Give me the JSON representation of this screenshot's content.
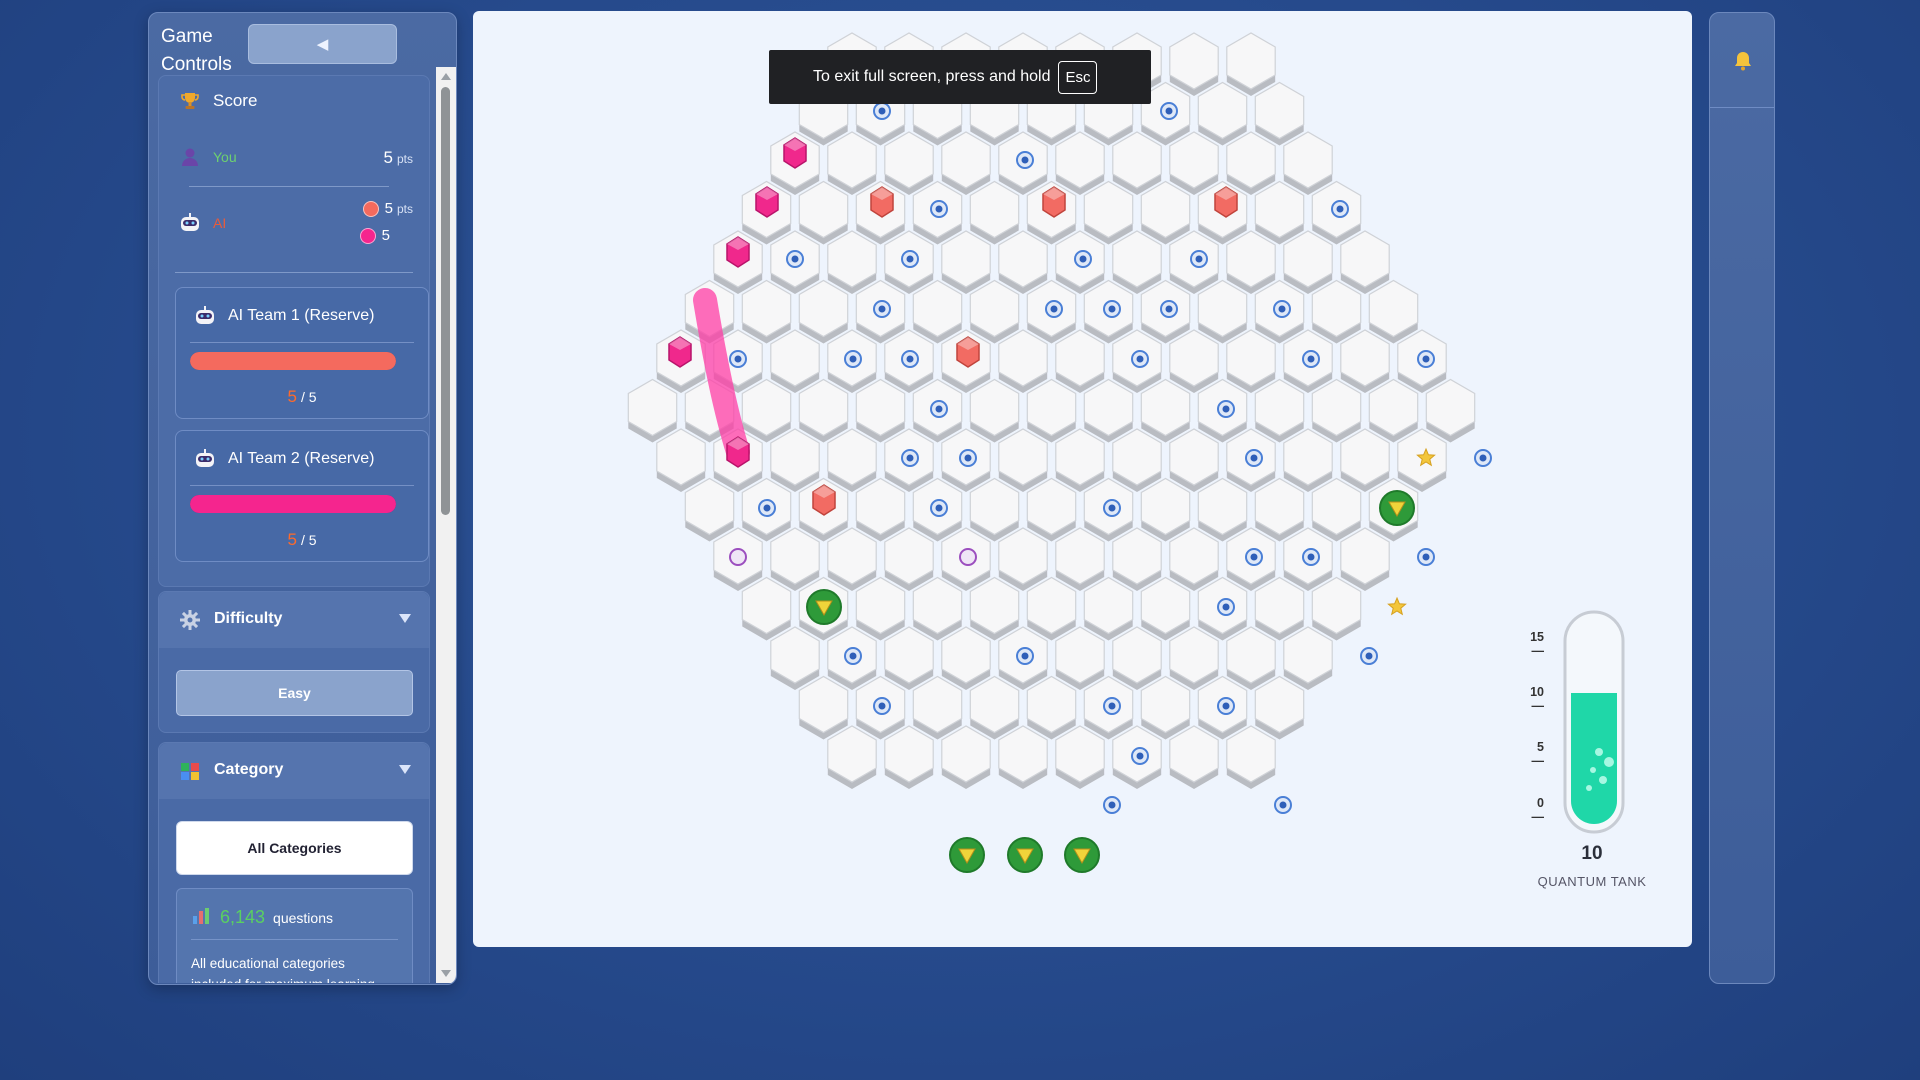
{
  "left_panel": {
    "title": "Game Controls",
    "collapse_icon": "◀",
    "score": {
      "title": "Score",
      "you": {
        "name": "You",
        "points": "5",
        "unit": "pts"
      },
      "ai": {
        "name": "AI",
        "team1_points": "5",
        "unit": "pts",
        "team2_points": "5"
      }
    },
    "teams": [
      {
        "label": "AI Team 1 (Reserve)",
        "current": "5",
        "total": "/ 5",
        "color": "#f46a5e",
        "fill": 1.0
      },
      {
        "label": "AI Team 2 (Reserve)",
        "current": "5",
        "total": "/ 5",
        "color": "#f5258e",
        "fill": 1.0
      }
    ],
    "difficulty": {
      "title": "Difficulty",
      "value": "Easy"
    },
    "category": {
      "title": "Category",
      "value": "All Categories",
      "question_count": "6,143",
      "question_label": "questions",
      "description": "All educational categories included for maximum learning variety! Each quest..."
    }
  },
  "toast": {
    "message": "To exit full screen, press and hold",
    "key": "Esc"
  },
  "tank": {
    "value": "10",
    "label": "QUANTUM TANK",
    "ticks": [
      "15 —",
      "10 —",
      "5 —",
      "0 —"
    ],
    "level": 10,
    "max": 15
  },
  "colors": {
    "background": "#264a8c",
    "panel": "#4a6aa6",
    "you_green": "#6dd16f",
    "ai_red": "#e85b3b",
    "team1": "#f46a5e",
    "team2": "#f5258e",
    "tank_liquid": "#1fd7a8"
  }
}
